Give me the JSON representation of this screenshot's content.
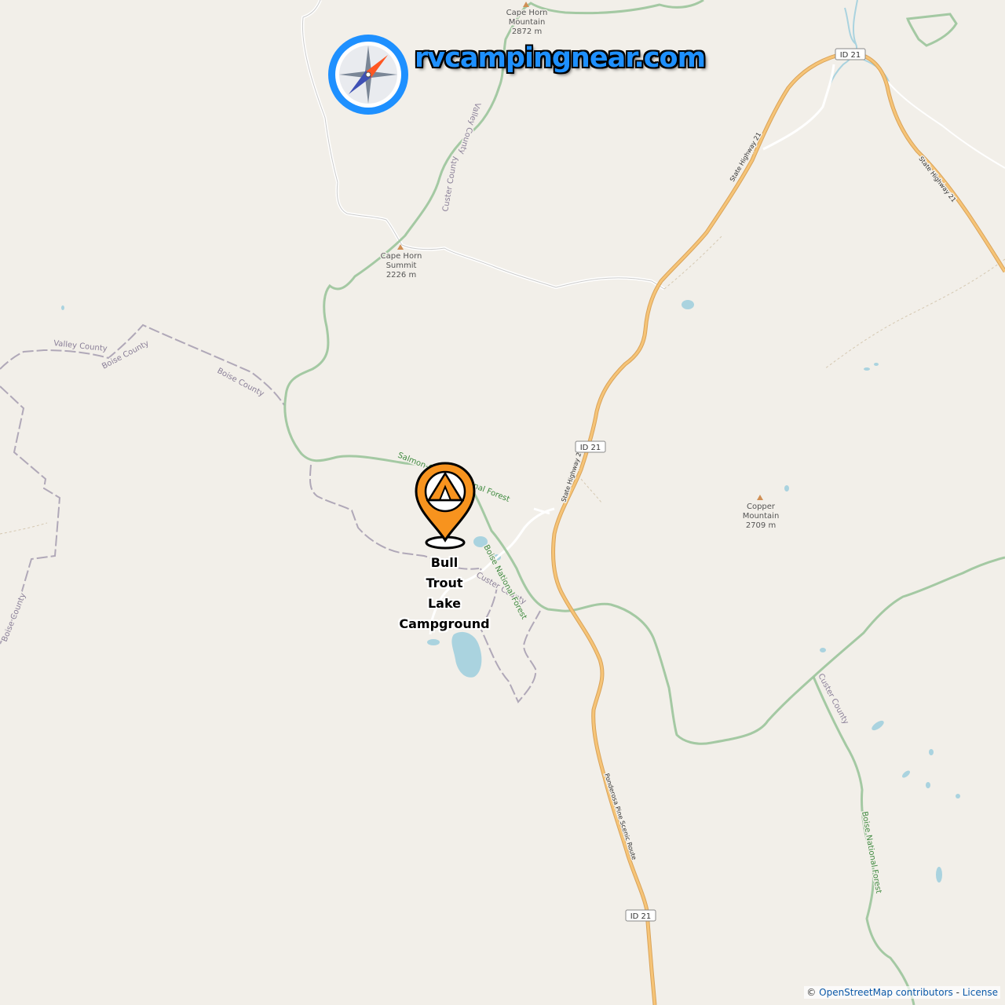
{
  "site": {
    "name": "rvcampingnear.com"
  },
  "campground": {
    "name_lines": [
      "Bull",
      "Trout",
      "Lake",
      "Campground"
    ],
    "marker_color": "#f7931e"
  },
  "peaks": [
    {
      "id": "cape-horn-mountain",
      "lines": [
        "Cape Horn",
        "Mountain",
        "2872 m"
      ]
    },
    {
      "id": "cape-horn-summit",
      "lines": [
        "Cape Horn",
        "Summit",
        "2226 m"
      ]
    },
    {
      "id": "copper-mountain",
      "lines": [
        "Copper",
        "Mountain",
        "2709 m"
      ]
    }
  ],
  "road_shields": [
    "ID 21",
    "ID 21",
    "ID 21"
  ],
  "road_labels": {
    "state_highway_21": "State Highway 21",
    "ponderosa": "Ponderosa Pine Scenic Route"
  },
  "boundary_labels": {
    "valley_county": "Valley County",
    "boise_county": "Boise County",
    "custer_county": "Custer County",
    "boise_national_forest": "Boise National Forest",
    "salmon_challis": "Salmon-Challis National Forest"
  },
  "attribution": {
    "prefix": "©",
    "link": "OpenStreetMap contributors",
    "separator": "-",
    "license": "License"
  },
  "colors": {
    "land": "#f2efe9",
    "forest_boundary": "#9bc49b",
    "county_boundary": "#b0a8b8",
    "highway": "#f6c477",
    "water": "#aad3df",
    "logo_blue": "#1e90ff"
  }
}
